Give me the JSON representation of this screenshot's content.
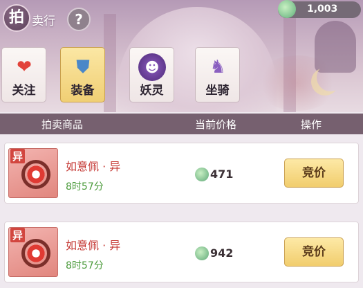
{
  "header": {
    "title_first": "拍",
    "title_rest": "卖行",
    "help_label": "?"
  },
  "currency": {
    "amount": "1,003",
    "icon": "jade-leaf-icon"
  },
  "categories": [
    {
      "label": "关注",
      "icon": "heart-icon",
      "active": false
    },
    {
      "label": "装备",
      "icon": "armor-icon",
      "active": true
    },
    {
      "label": "妖灵",
      "icon": "demon-spirit-icon",
      "active": false
    },
    {
      "label": "坐骑",
      "icon": "mount-icon",
      "active": false
    }
  ],
  "table": {
    "columns": [
      "拍卖商品",
      "当前价格",
      "操作"
    ],
    "rows": [
      {
        "tag": "异",
        "name": "如意佩 · 异",
        "time_left": "8时57分",
        "price": "471",
        "action": "竞价"
      },
      {
        "tag": "异",
        "name": "如意佩 · 异",
        "time_left": "8时57分",
        "price": "942",
        "action": "竞价"
      }
    ]
  },
  "colors": {
    "header_bar": "#76606f",
    "active_tab": "#f0cf74",
    "item_name": "#c63b37",
    "timer": "#4a9a3a"
  }
}
